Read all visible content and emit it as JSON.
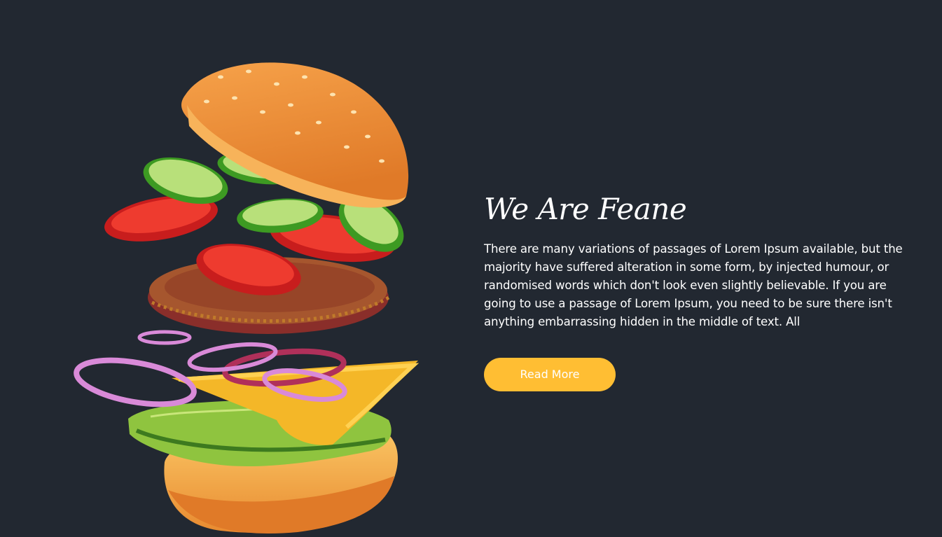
{
  "about": {
    "heading": "We Are Feane",
    "body": "There are many variations of passages of Lorem Ipsum available, but the majority have suffered alteration in some form, by injected humour, or randomised words which don't look even slightly believable. If you are going to use a passage of Lorem Ipsum, you need to be sure there isn't anything embarrassing hidden in the middle of text. All",
    "button_label": "Read More"
  },
  "image": {
    "subject": "exploded-burger-illustration"
  },
  "colors": {
    "background": "#222831",
    "accent": "#ffbe33",
    "text": "#ffffff"
  }
}
